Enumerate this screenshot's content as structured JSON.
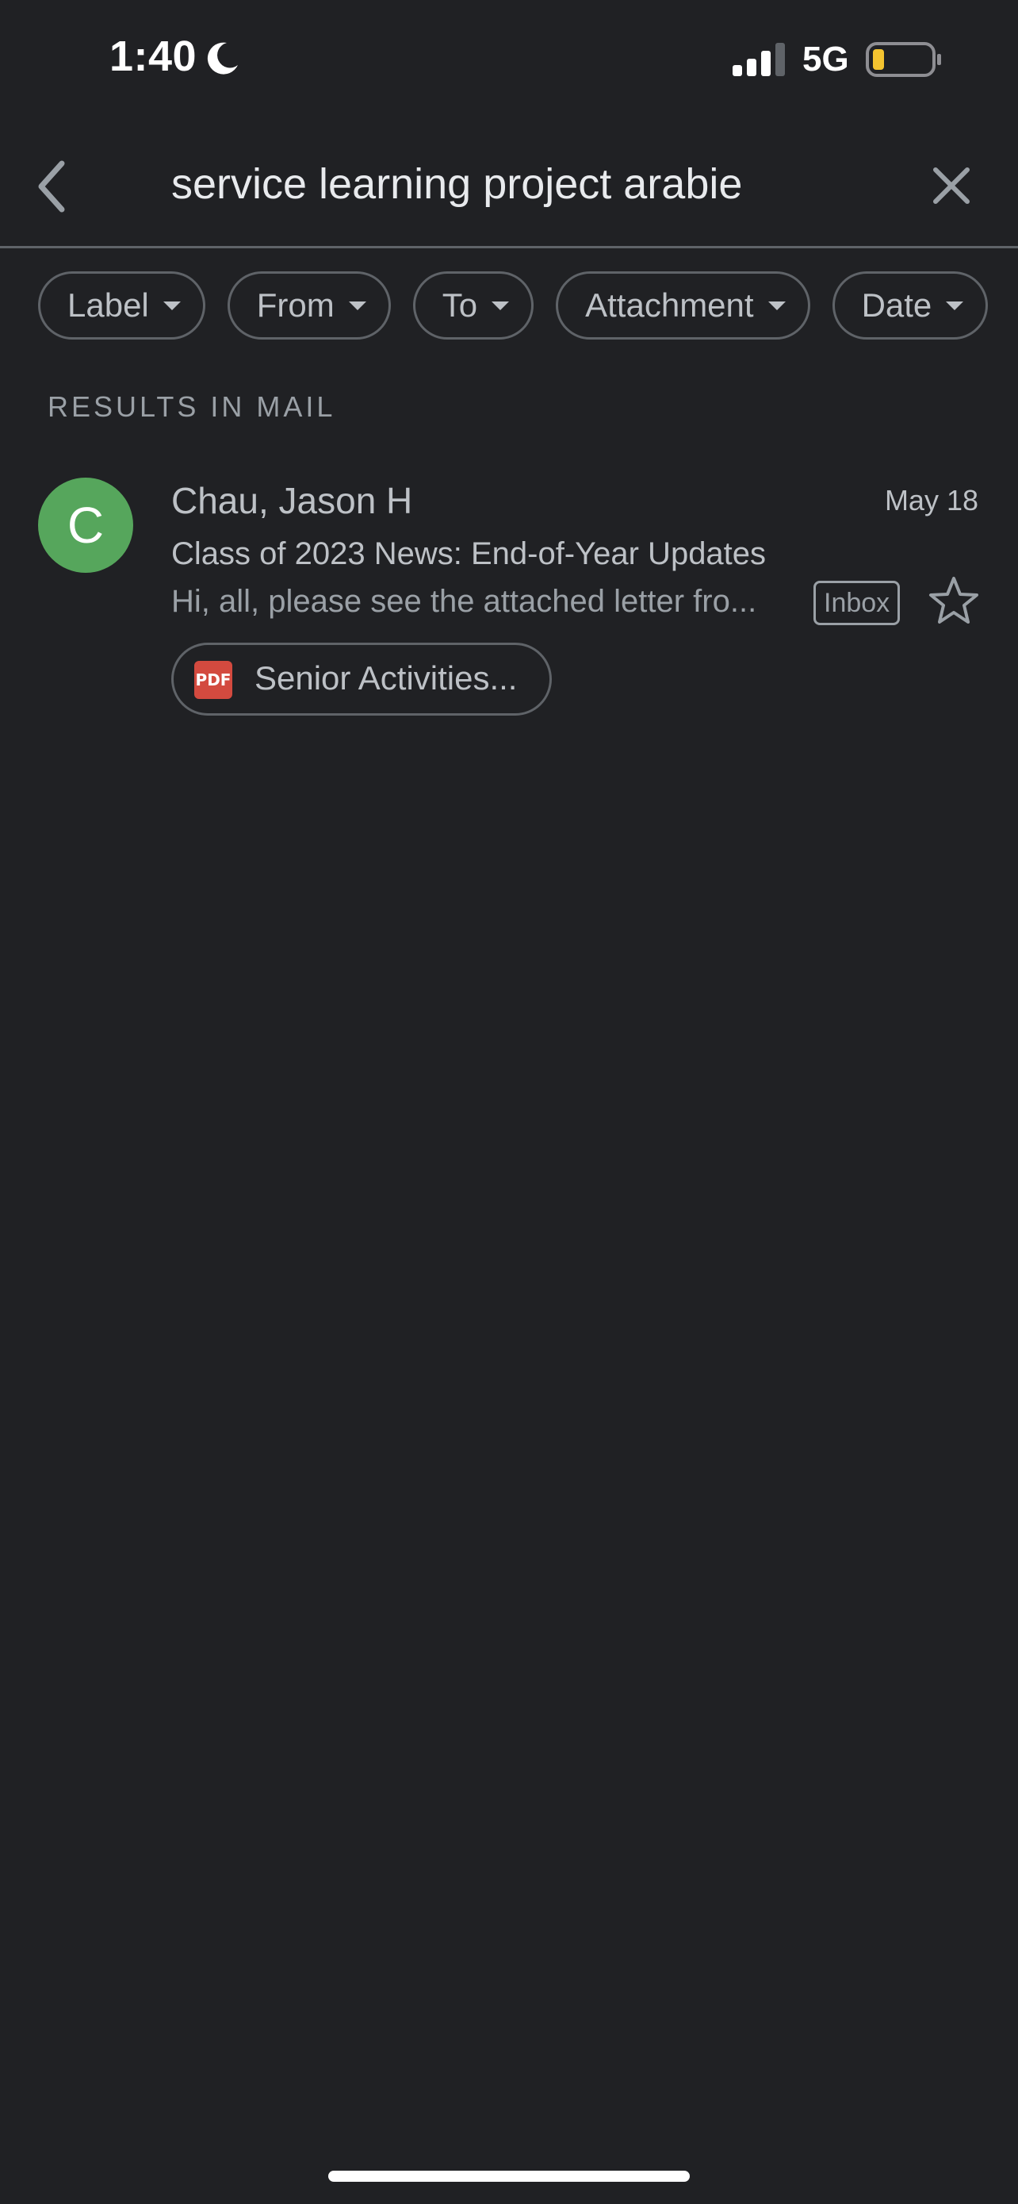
{
  "status_bar": {
    "time": "1:40",
    "network": "5G",
    "battery_color": "#f4c430"
  },
  "search": {
    "query": "service learning project arabie"
  },
  "filters": [
    {
      "label": "Label"
    },
    {
      "label": "From"
    },
    {
      "label": "To"
    },
    {
      "label": "Attachment"
    },
    {
      "label": "Date"
    }
  ],
  "section_header": "RESULTS IN MAIL",
  "results": [
    {
      "avatar_letter": "C",
      "avatar_color": "#56a65c",
      "sender": "Chau, Jason H",
      "date": "May 18",
      "subject": "Class of 2023 News: End-of-Year Updates",
      "snippet": "Hi, all, please see the attached letter fro...",
      "label": "Inbox",
      "attachment": {
        "type_label": "PDF",
        "name": "Senior Activities..."
      }
    }
  ]
}
